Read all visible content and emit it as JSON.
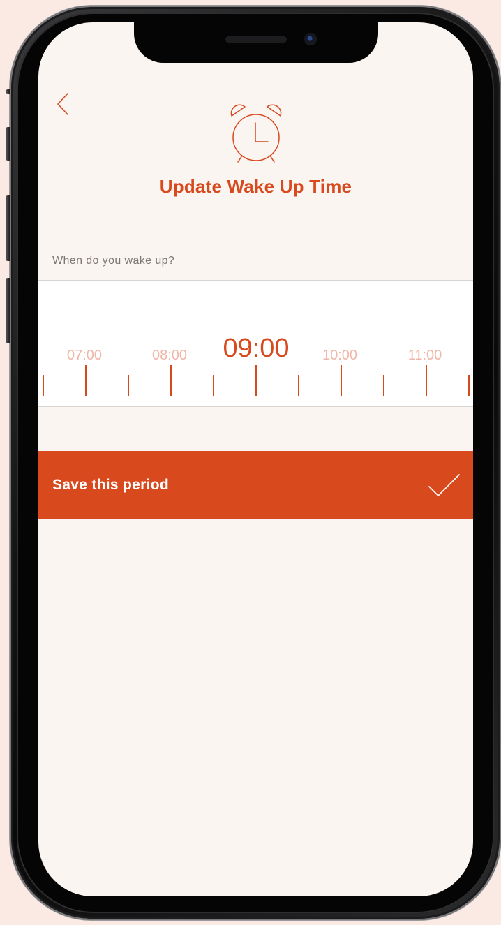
{
  "header": {
    "title": "Update Wake Up Time",
    "back_icon": "chevron-left-icon",
    "illustration_icon": "alarm-clock-icon"
  },
  "picker": {
    "question": "When do you wake up?",
    "times": [
      "07:00",
      "08:00",
      "09:00",
      "10:00",
      "11:00"
    ],
    "selected_time": "09:00"
  },
  "save": {
    "label": "Save this period",
    "icon": "checkmark-icon"
  },
  "colors": {
    "accent": "#d84a1e",
    "accent_faded": "#f0b7a8",
    "screen_background": "#fbf5f1",
    "page_background": "#fbe9e4"
  }
}
